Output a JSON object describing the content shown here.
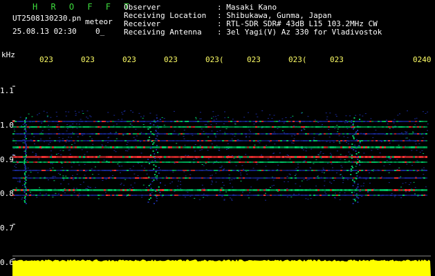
{
  "header": {
    "brand": "H R O F F T",
    "file_name": "UT2508130230.pn",
    "meteor_label": "meteor",
    "datetime": "25.08.13 02:30",
    "count": "0_"
  },
  "info": [
    {
      "label": "Observer",
      "value": ": Masaki Kano"
    },
    {
      "label": "Receiving Location",
      "value": ": Shibukawa, Gunma, Japan"
    },
    {
      "label": "Receiver",
      "value": ": RTL-SDR SDR# 43dB L15 103.2MHz CW"
    },
    {
      "label": "Receiving Antenna",
      "value": ": 3el Yagi(V) Az 330 for Vladivostok"
    }
  ],
  "axis": {
    "y_unit": "kHz",
    "y_ticks": [
      "1.1",
      "1.0",
      "0.9",
      "0.8",
      "0.7",
      "0.6"
    ],
    "x_ticks": [
      "023",
      "023",
      "023",
      "023",
      "023(",
      "023",
      "023(",
      "023",
      "0240"
    ]
  },
  "colors": {
    "background": "#000000",
    "brand": "#3ddc3d",
    "tick_label": "#ffff66",
    "noise_band": "#ffff00",
    "signal_strong": "#ff3333",
    "signal_mid": "#00cc66",
    "signal_low": "#1a2a9a"
  }
}
